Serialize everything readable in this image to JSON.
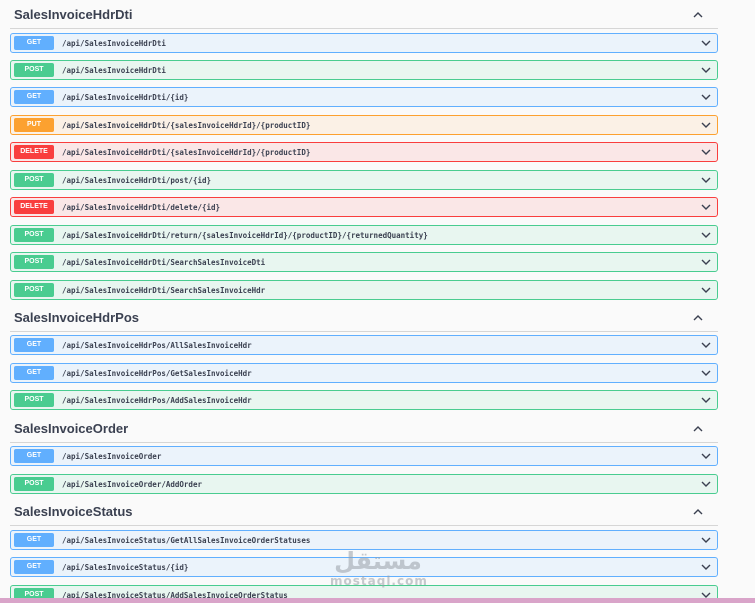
{
  "sections": [
    {
      "title": "SalesInvoiceHdrDti",
      "operations": [
        {
          "method": "GET",
          "path": "/api/SalesInvoiceHdrDti"
        },
        {
          "method": "POST",
          "path": "/api/SalesInvoiceHdrDti"
        },
        {
          "method": "GET",
          "path": "/api/SalesInvoiceHdrDti/{id}"
        },
        {
          "method": "PUT",
          "path": "/api/SalesInvoiceHdrDti/{salesInvoiceHdrId}/{productID}"
        },
        {
          "method": "DELETE",
          "path": "/api/SalesInvoiceHdrDti/{salesInvoiceHdrId}/{productID}"
        },
        {
          "method": "POST",
          "path": "/api/SalesInvoiceHdrDti/post/{id}"
        },
        {
          "method": "DELETE",
          "path": "/api/SalesInvoiceHdrDti/delete/{id}"
        },
        {
          "method": "POST",
          "path": "/api/SalesInvoiceHdrDti/return/{salesInvoiceHdrId}/{productID}/{returnedQuantity}"
        },
        {
          "method": "POST",
          "path": "/api/SalesInvoiceHdrDti/SearchSalesInvoiceDti"
        },
        {
          "method": "POST",
          "path": "/api/SalesInvoiceHdrDti/SearchSalesInvoiceHdr"
        }
      ]
    },
    {
      "title": "SalesInvoiceHdrPos",
      "operations": [
        {
          "method": "GET",
          "path": "/api/SalesInvoiceHdrPos/AllSalesInvoiceHdr"
        },
        {
          "method": "GET",
          "path": "/api/SalesInvoiceHdrPos/GetSalesInvoiceHdr"
        },
        {
          "method": "POST",
          "path": "/api/SalesInvoiceHdrPos/AddSalesInvoiceHdr"
        }
      ]
    },
    {
      "title": "SalesInvoiceOrder",
      "operations": [
        {
          "method": "GET",
          "path": "/api/SalesInvoiceOrder"
        },
        {
          "method": "POST",
          "path": "/api/SalesInvoiceOrder/AddOrder"
        }
      ]
    },
    {
      "title": "SalesInvoiceStatus",
      "operations": [
        {
          "method": "GET",
          "path": "/api/SalesInvoiceStatus/GetAllSalesInvoiceOrderStatuses"
        },
        {
          "method": "GET",
          "path": "/api/SalesInvoiceStatus/{id}"
        },
        {
          "method": "POST",
          "path": "/api/SalesInvoiceStatus/AddSalesInvoiceOrderStatus"
        }
      ]
    }
  ],
  "watermark": {
    "arabic": "مستقل",
    "latin": "mostaql.com"
  },
  "colors": {
    "get": "#61affe",
    "post": "#49cc90",
    "put": "#fca130",
    "delete": "#f93e3e"
  },
  "icons": {
    "collapse": "chevron-up-icon",
    "expand": "chevron-down-icon"
  }
}
